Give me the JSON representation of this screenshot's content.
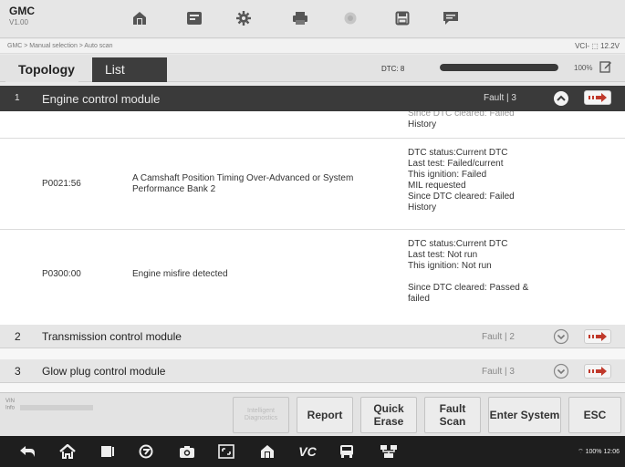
{
  "app": {
    "name": "GMC",
    "version": "V1.00"
  },
  "toolbar": {
    "icons": [
      "home-icon",
      "vehicle-icon",
      "settings-icon",
      "print-icon",
      "record-icon",
      "save-icon",
      "chat-icon"
    ]
  },
  "breadcrumb": {
    "text": "GMC > Manual selection > Auto scan",
    "vci": "VCI- ⬚ 12.2V"
  },
  "tabs": [
    {
      "label": "Topology"
    },
    {
      "label": "List"
    }
  ],
  "scan": {
    "dtc_label": "DTC: 8",
    "progress": 1.0,
    "progress_label": "100%"
  },
  "modules": [
    {
      "number": "1",
      "name": "Engine control module",
      "fault": "Fault | 3"
    },
    {
      "number": "2",
      "name": "Transmission control module",
      "fault": "Fault | 2"
    },
    {
      "number": "3",
      "name": "Glow plug control module",
      "fault": "Fault | 3"
    }
  ],
  "dtcs": [
    {
      "code": "",
      "description": "",
      "status": [
        "Since DTC cleared: Failed",
        "History"
      ]
    },
    {
      "code": "P0021:56",
      "description": "A Camshaft Position Timing Over-Advanced or System Performance Bank 2",
      "status": [
        "DTC status:Current DTC",
        "Last test: Failed/current",
        "This ignition: Failed",
        "MIL requested",
        "Since DTC cleared: Failed",
        "History"
      ]
    },
    {
      "code": "P0300:00",
      "description": "Engine misfire detected",
      "status": [
        "DTC status:Current DTC",
        "Last test: Not run",
        "This ignition: Not run",
        "",
        "Since DTC cleared: Passed &",
        "failed"
      ]
    }
  ],
  "bottom": {
    "vin_label": "VIN",
    "info_label": "Info",
    "buttons": {
      "intelligent": "Intelligent Diagnostics",
      "report": "Report",
      "quick_erase": "Quick Erase",
      "fault_scan": "Fault Scan",
      "enter_system": "Enter System",
      "esc": "ESC"
    }
  },
  "system_bar": {
    "status": "100% 12:06",
    "vc_label": "VC"
  }
}
